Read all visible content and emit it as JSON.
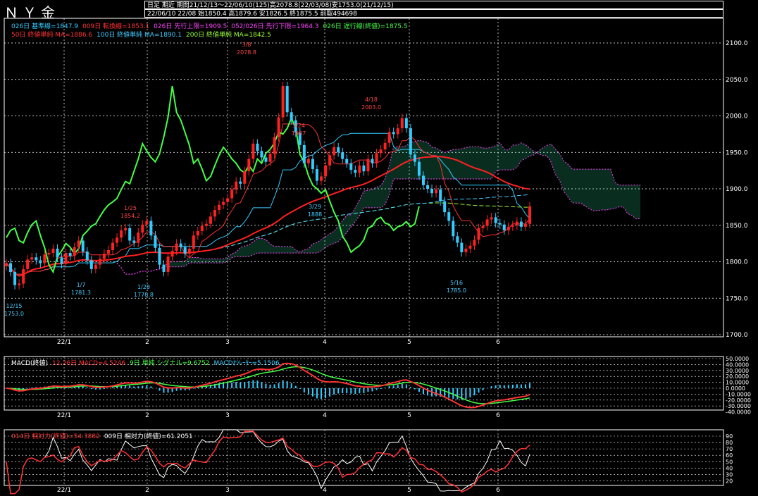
{
  "header": {
    "title": "ＮＹ金",
    "info1": "日足 期近 期間21/12/13～22/06/10(125)高2078.8(22/03/08)安1753.0(21/12/15)",
    "info2": "22/06/10 22/08 始1850.4 高1879.6 安1826.5 終1875.5 前取494698"
  },
  "legends": {
    "main1": [
      {
        "text": "026日 基準線=1847.9",
        "color": "#33ccff"
      },
      {
        "text": "009日 転換線=1853.1",
        "color": "#ff3333"
      },
      {
        "text": "026日 先行上限=1909.5",
        "color": "#ff44ff"
      },
      {
        "text": "052/026日 先行下限=1964.3",
        "color": "#ff44ff"
      },
      {
        "text": "026日 遅行線(終値)=1875.5",
        "color": "#44ff44"
      }
    ],
    "main2": [
      {
        "text": "50日 終値単純 MA=1886.6",
        "color": "#ff3333"
      },
      {
        "text": "100日 終値単純 MA=1890.1",
        "color": "#44ccff"
      },
      {
        "text": "200日 終値単純 MA=1842.5",
        "color": "#99ff33"
      }
    ],
    "macd": [
      {
        "text": "MACD(終値)",
        "color": "#ffffff"
      },
      {
        "text": "12-26日 MACD=4.5246",
        "color": "#ff3333"
      },
      {
        "text": "9日 単純 シグナル=9.6752",
        "color": "#44ff44"
      },
      {
        "text": "MACDｵｼﾚｰﾀｰ=5.1506",
        "color": "#33ccff"
      }
    ],
    "rsi": [
      {
        "text": "014日 相対力(終値)=54.3882",
        "color": "#ff3333"
      },
      {
        "text": "009日 相対力(終値)=61.2051",
        "color": "#ffffff"
      }
    ]
  },
  "colors": {
    "bg": "#000000",
    "grid": "#ffffff",
    "up": "#ff2020",
    "down": "#33ccff",
    "kijun": "#33ccff",
    "tenkan": "#ff3333",
    "spanA": "#ff44ff",
    "chikou": "#44ff44",
    "ma50": "#ff2020",
    "ma100": "#44ccff",
    "ma200": "#99ff33",
    "cloud": "#33ffaa"
  },
  "chart_data": [
    {
      "type": "candlestick",
      "title": "ＮＹ金 日足",
      "x_tick_labels": [
        "22/1",
        "2",
        "3",
        "4",
        "5",
        "6"
      ],
      "y_tick_labels": [
        "2100.0",
        "2050.0",
        "2000.0",
        "1950.0",
        "1900.0",
        "1850.0",
        "1800.0",
        "1750.0",
        "1700.0"
      ],
      "ylim": [
        1700,
        2100
      ],
      "closes": [
        1798,
        1786,
        1768,
        1770,
        1790,
        1803,
        1806,
        1802,
        1798,
        1810,
        1812,
        1818,
        1806,
        1797,
        1812,
        1808,
        1820,
        1829,
        1814,
        1802,
        1790,
        1796,
        1804,
        1811,
        1816,
        1826,
        1833,
        1843,
        1846,
        1829,
        1826,
        1840,
        1851,
        1856,
        1836,
        1819,
        1796,
        1786,
        1807,
        1815,
        1825,
        1820,
        1811,
        1818,
        1836,
        1842,
        1849,
        1852,
        1862,
        1871,
        1878,
        1882,
        1887,
        1899,
        1910,
        1907,
        1924,
        1941,
        1962,
        1952,
        1943,
        1937,
        1948,
        1971,
        1998,
        2041,
        2005,
        1994,
        1977,
        1960,
        1935,
        1941,
        1927,
        1911,
        1917,
        1932,
        1946,
        1957,
        1950,
        1941,
        1935,
        1926,
        1922,
        1932,
        1924,
        1941,
        1935,
        1949,
        1954,
        1963,
        1978,
        1975,
        1983,
        1997,
        1983,
        1947,
        1937,
        1918,
        1905,
        1900,
        1894,
        1899,
        1883,
        1868,
        1856,
        1835,
        1826,
        1813,
        1818,
        1822,
        1830,
        1846,
        1849,
        1858,
        1861,
        1853,
        1851,
        1843,
        1848,
        1850,
        1855,
        1848,
        1852,
        1876
      ],
      "annotations": [
        {
          "label": "12/15",
          "value": "1753.0"
        },
        {
          "label": "1/7",
          "value": "1781.3"
        },
        {
          "label": "1/25",
          "value": "1854.2"
        },
        {
          "label": "1/28",
          "value": "1778.8"
        },
        {
          "label": "3/8",
          "value": "2078.8"
        },
        {
          "label": "3/24",
          "value": "1987"
        },
        {
          "label": "3/29",
          "value": "1888"
        },
        {
          "label": "4/18",
          "value": "2003.0"
        },
        {
          "label": "5/16",
          "value": "1785.0"
        }
      ]
    },
    {
      "type": "line",
      "title": "MACD(終値)",
      "y_tick_labels": [
        "50.0000",
        "40.0000",
        "30.0000",
        "20.0000",
        "10.0000",
        "0.0000",
        "-10.0000",
        "-20.0000",
        "-30.0000",
        "-40.0000"
      ],
      "ylim": [
        -50,
        50
      ]
    },
    {
      "type": "line",
      "title": "相対力",
      "y_tick_labels": [
        "90",
        "80",
        "70",
        "60",
        "50",
        "40",
        "30",
        "20"
      ],
      "ylim": [
        15,
        95
      ]
    }
  ]
}
